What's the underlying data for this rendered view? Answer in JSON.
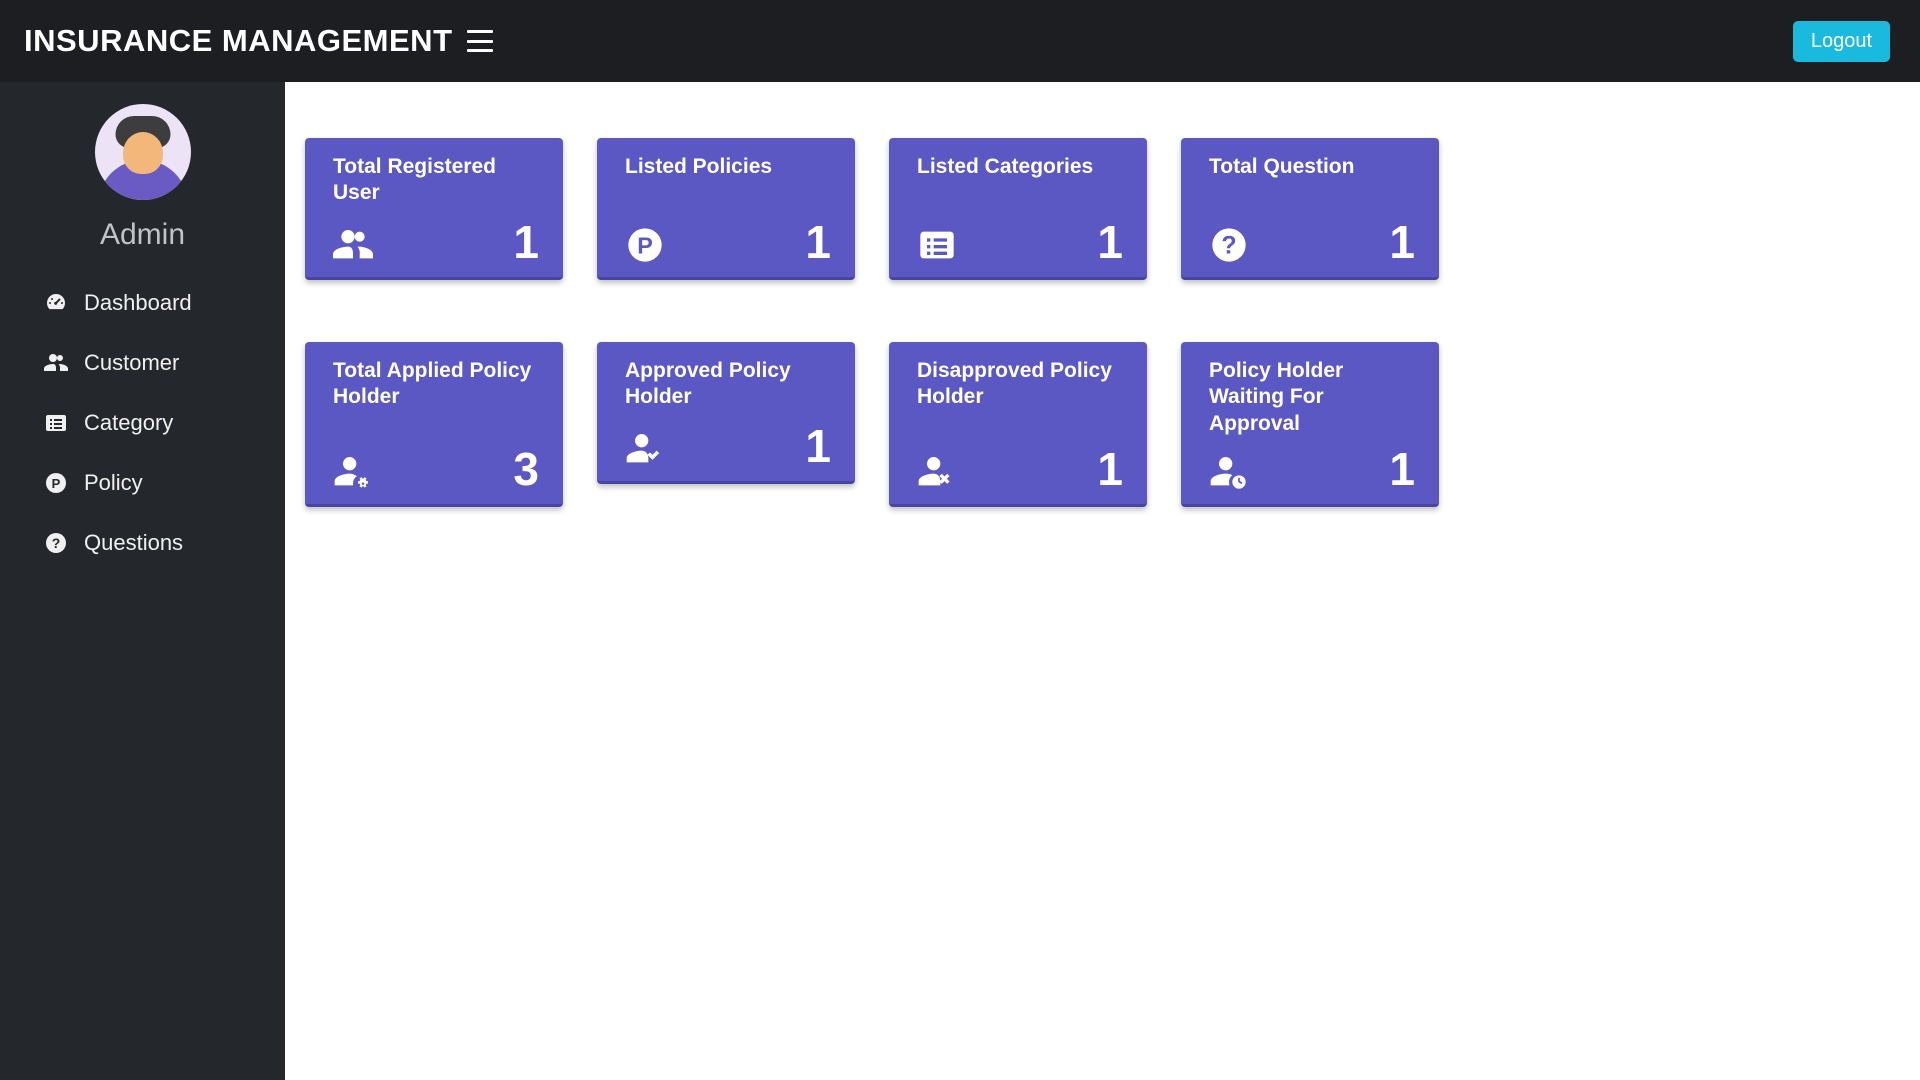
{
  "app": {
    "title": "INSURANCE MANAGEMENT",
    "logout": "Logout"
  },
  "user": {
    "role_label": "Admin"
  },
  "sidebar": {
    "items": [
      {
        "label": "Dashboard"
      },
      {
        "label": "Customer"
      },
      {
        "label": "Category"
      },
      {
        "label": "Policy"
      },
      {
        "label": "Questions"
      }
    ]
  },
  "cards": [
    {
      "title": "Total Registered User",
      "value": "1"
    },
    {
      "title": "Listed Policies",
      "value": "1"
    },
    {
      "title": "Listed Categories",
      "value": "1"
    },
    {
      "title": "Total Question",
      "value": "1"
    },
    {
      "title": "Total Applied Policy Holder",
      "value": "3"
    },
    {
      "title": "Approved Policy Holder",
      "value": "1"
    },
    {
      "title": "Disapproved Policy Holder",
      "value": "1"
    },
    {
      "title": "Policy Holder Waiting For Approval",
      "value": "1"
    }
  ]
}
